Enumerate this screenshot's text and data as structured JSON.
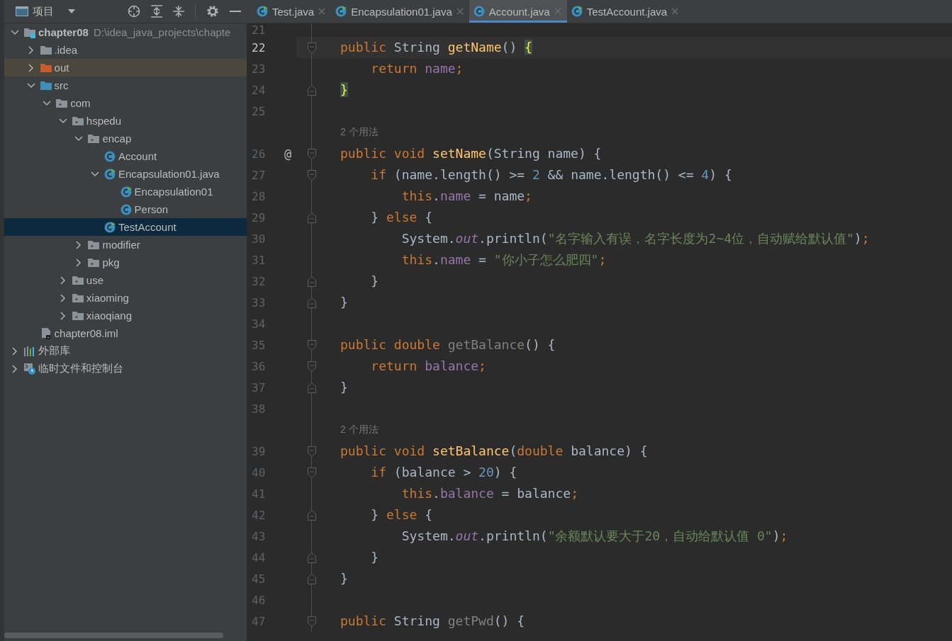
{
  "project_header": {
    "label": "项目"
  },
  "tabs": [
    {
      "label": "Test.java",
      "kind": "runnable-class",
      "selected": false
    },
    {
      "label": "Encapsulation01.java",
      "kind": "runnable-class",
      "selected": false
    },
    {
      "label": "Account.java",
      "kind": "class",
      "selected": true
    },
    {
      "label": "TestAccount.java",
      "kind": "runnable-class",
      "selected": false
    }
  ],
  "project_tree": {
    "items": [
      {
        "label": "chapter08",
        "path": "D:\\idea_java_projects\\chapte",
        "kind": "module",
        "expanded": true,
        "selected": false,
        "children": [
          {
            "label": ".idea",
            "kind": "folder",
            "expanded": false,
            "selected": false
          },
          {
            "label": "out",
            "kind": "excluded-folder",
            "expanded": false,
            "selected": false
          },
          {
            "label": "src",
            "kind": "source-folder",
            "expanded": true,
            "selected": false,
            "children": [
              {
                "label": "com",
                "kind": "package",
                "expanded": true,
                "selected": false,
                "children": [
                  {
                    "label": "hspedu",
                    "kind": "package",
                    "expanded": true,
                    "selected": false,
                    "children": [
                      {
                        "label": "encap",
                        "kind": "package",
                        "expanded": true,
                        "selected": false,
                        "children": [
                          {
                            "label": "Account",
                            "kind": "class",
                            "selected": false
                          },
                          {
                            "label": "Encapsulation01.java",
                            "kind": "runnable-class",
                            "expanded": true,
                            "selected": false,
                            "children": [
                              {
                                "label": "Encapsulation01",
                                "kind": "runnable-class",
                                "selected": false
                              },
                              {
                                "label": "Person",
                                "kind": "class",
                                "selected": false
                              }
                            ]
                          },
                          {
                            "label": "TestAccount",
                            "kind": "runnable-class",
                            "selected": true
                          }
                        ]
                      },
                      {
                        "label": "modifier",
                        "kind": "package",
                        "expanded": false,
                        "selected": false
                      },
                      {
                        "label": "pkg",
                        "kind": "package",
                        "expanded": false,
                        "selected": false
                      }
                    ]
                  },
                  {
                    "label": "use",
                    "kind": "package",
                    "expanded": false,
                    "selected": false
                  },
                  {
                    "label": "xiaoming",
                    "kind": "package",
                    "expanded": false,
                    "selected": false
                  },
                  {
                    "label": "xiaoqiang",
                    "kind": "package",
                    "expanded": false,
                    "selected": false
                  }
                ]
              }
            ]
          },
          {
            "label": "chapter08.iml",
            "kind": "iml",
            "selected": false
          }
        ]
      },
      {
        "label": "外部库",
        "kind": "libraries",
        "expanded": false,
        "selected": false
      },
      {
        "label": "临时文件和控制台",
        "kind": "scratches",
        "expanded": false,
        "selected": false
      }
    ]
  },
  "editor": {
    "lines": [
      {
        "kind": "code",
        "number": "21",
        "current": false,
        "fold_start": false,
        "fold_end": false
      },
      {
        "kind": "code",
        "number": "22",
        "current": true,
        "fold_start": true,
        "fold_end": false,
        "tokens": [
          {
            "kind": "kw",
            "text": "public "
          },
          {
            "kind": "plain",
            "text": "String "
          },
          {
            "kind": "decl",
            "text": "getName"
          },
          {
            "kind": "plain",
            "text": "() "
          },
          {
            "kind": "brace",
            "text": "{"
          }
        ]
      },
      {
        "kind": "code",
        "number": "23",
        "current": false,
        "fold_start": false,
        "fold_end": false,
        "tokens": [
          {
            "kind": "kw",
            "text": "    return "
          },
          {
            "kind": "field",
            "text": "name"
          },
          {
            "kind": "kw",
            "text": ";"
          }
        ]
      },
      {
        "kind": "code",
        "number": "24",
        "current": false,
        "fold_start": false,
        "fold_end": true,
        "tokens": [
          {
            "kind": "brace",
            "text": "}"
          }
        ]
      },
      {
        "kind": "code",
        "number": "25",
        "current": false,
        "fold_start": false,
        "fold_end": false
      },
      {
        "kind": "hint",
        "text": "2 个用法"
      },
      {
        "kind": "code",
        "number": "26",
        "current": false,
        "mark": "@",
        "fold_start": true,
        "fold_end": false,
        "tokens": [
          {
            "kind": "kw",
            "text": "public void "
          },
          {
            "kind": "decl",
            "text": "setName"
          },
          {
            "kind": "plain",
            "text": "(String name) {"
          }
        ]
      },
      {
        "kind": "code",
        "number": "27",
        "current": false,
        "fold_start": true,
        "fold_end": false,
        "tokens": [
          {
            "kind": "kw",
            "text": "    if "
          },
          {
            "kind": "plain",
            "text": "(name.length() >= "
          },
          {
            "kind": "num",
            "text": "2"
          },
          {
            "kind": "plain",
            "text": " && name.length() <= "
          },
          {
            "kind": "num",
            "text": "4"
          },
          {
            "kind": "plain",
            "text": ") {"
          }
        ]
      },
      {
        "kind": "code",
        "number": "28",
        "current": false,
        "fold_start": false,
        "fold_end": false,
        "tokens": [
          {
            "kind": "kw",
            "text": "        this"
          },
          {
            "kind": "plain",
            "text": "."
          },
          {
            "kind": "field",
            "text": "name"
          },
          {
            "kind": "plain",
            "text": " = name"
          },
          {
            "kind": "kw",
            "text": ";"
          }
        ]
      },
      {
        "kind": "code",
        "number": "29",
        "current": false,
        "fold_start": false,
        "fold_end": true,
        "tokens": [
          {
            "kind": "plain",
            "text": "    } "
          },
          {
            "kind": "kw",
            "text": "else "
          },
          {
            "kind": "plain",
            "text": "{"
          }
        ]
      },
      {
        "kind": "code",
        "number": "30",
        "current": false,
        "fold_start": false,
        "fold_end": false,
        "tokens": [
          {
            "kind": "plain",
            "text": "        System."
          },
          {
            "kind": "static",
            "text": "out"
          },
          {
            "kind": "plain",
            "text": ".println("
          },
          {
            "kind": "str",
            "text": "\"名字输入有误，名字长度为2~4位，自动赋给默认值\""
          },
          {
            "kind": "plain",
            "text": ")"
          },
          {
            "kind": "kw",
            "text": ";"
          }
        ]
      },
      {
        "kind": "code",
        "number": "31",
        "current": false,
        "fold_start": false,
        "fold_end": false,
        "tokens": [
          {
            "kind": "kw",
            "text": "        this"
          },
          {
            "kind": "plain",
            "text": "."
          },
          {
            "kind": "field",
            "text": "name"
          },
          {
            "kind": "plain",
            "text": " = "
          },
          {
            "kind": "str",
            "text": "\"你小子怎么肥四\""
          },
          {
            "kind": "kw",
            "text": ";"
          }
        ]
      },
      {
        "kind": "code",
        "number": "32",
        "current": false,
        "fold_start": false,
        "fold_end": true,
        "tokens": [
          {
            "kind": "plain",
            "text": "    }"
          }
        ]
      },
      {
        "kind": "code",
        "number": "33",
        "current": false,
        "fold_start": false,
        "fold_end": true,
        "tokens": [
          {
            "kind": "plain",
            "text": "}"
          }
        ]
      },
      {
        "kind": "code",
        "number": "34",
        "current": false,
        "fold_start": false,
        "fold_end": false
      },
      {
        "kind": "code",
        "number": "35",
        "current": false,
        "fold_start": true,
        "fold_end": false,
        "tokens": [
          {
            "kind": "kw",
            "text": "public double "
          },
          {
            "kind": "unused",
            "text": "getBalance"
          },
          {
            "kind": "plain",
            "text": "() {"
          }
        ]
      },
      {
        "kind": "code",
        "number": "36",
        "current": false,
        "fold_start": true,
        "fold_end": false,
        "tokens": [
          {
            "kind": "kw",
            "text": "    return "
          },
          {
            "kind": "field",
            "text": "balance"
          },
          {
            "kind": "kw",
            "text": ";"
          }
        ]
      },
      {
        "kind": "code",
        "number": "37",
        "current": false,
        "fold_start": false,
        "fold_end": true,
        "tokens": [
          {
            "kind": "plain",
            "text": "}"
          }
        ]
      },
      {
        "kind": "code",
        "number": "38",
        "current": false,
        "fold_start": false,
        "fold_end": false
      },
      {
        "kind": "hint",
        "text": "2 个用法"
      },
      {
        "kind": "code",
        "number": "39",
        "current": false,
        "fold_start": true,
        "fold_end": false,
        "tokens": [
          {
            "kind": "kw",
            "text": "public void "
          },
          {
            "kind": "decl",
            "text": "setBalance"
          },
          {
            "kind": "plain",
            "text": "("
          },
          {
            "kind": "kw",
            "text": "double "
          },
          {
            "kind": "plain",
            "text": "balance) {"
          }
        ]
      },
      {
        "kind": "code",
        "number": "40",
        "current": false,
        "fold_start": true,
        "fold_end": false,
        "tokens": [
          {
            "kind": "kw",
            "text": "    if "
          },
          {
            "kind": "plain",
            "text": "(balance > "
          },
          {
            "kind": "num",
            "text": "20"
          },
          {
            "kind": "plain",
            "text": ") {"
          }
        ]
      },
      {
        "kind": "code",
        "number": "41",
        "current": false,
        "fold_start": false,
        "fold_end": false,
        "tokens": [
          {
            "kind": "kw",
            "text": "        this"
          },
          {
            "kind": "plain",
            "text": "."
          },
          {
            "kind": "field",
            "text": "balance"
          },
          {
            "kind": "plain",
            "text": " = balance"
          },
          {
            "kind": "kw",
            "text": ";"
          }
        ]
      },
      {
        "kind": "code",
        "number": "42",
        "current": false,
        "fold_start": false,
        "fold_end": true,
        "tokens": [
          {
            "kind": "plain",
            "text": "    } "
          },
          {
            "kind": "kw",
            "text": "else "
          },
          {
            "kind": "plain",
            "text": "{"
          }
        ]
      },
      {
        "kind": "code",
        "number": "43",
        "current": false,
        "fold_start": false,
        "fold_end": false,
        "tokens": [
          {
            "kind": "plain",
            "text": "        System."
          },
          {
            "kind": "static",
            "text": "out"
          },
          {
            "kind": "plain",
            "text": ".println("
          },
          {
            "kind": "str",
            "text": "\"余额默认要大于20，自动给默认值 0\""
          },
          {
            "kind": "plain",
            "text": ")"
          },
          {
            "kind": "kw",
            "text": ";"
          }
        ]
      },
      {
        "kind": "code",
        "number": "44",
        "current": false,
        "fold_start": false,
        "fold_end": true,
        "tokens": [
          {
            "kind": "plain",
            "text": "    }"
          }
        ]
      },
      {
        "kind": "code",
        "number": "45",
        "current": false,
        "fold_start": false,
        "fold_end": true,
        "tokens": [
          {
            "kind": "plain",
            "text": "}"
          }
        ]
      },
      {
        "kind": "code",
        "number": "46",
        "current": false,
        "fold_start": false,
        "fold_end": false
      },
      {
        "kind": "code",
        "number": "47",
        "current": false,
        "fold_start": true,
        "fold_end": false,
        "tokens": [
          {
            "kind": "kw",
            "text": "public "
          },
          {
            "kind": "plain",
            "text": "String "
          },
          {
            "kind": "unused",
            "text": "getPwd"
          },
          {
            "kind": "plain",
            "text": "() {"
          }
        ]
      }
    ]
  }
}
